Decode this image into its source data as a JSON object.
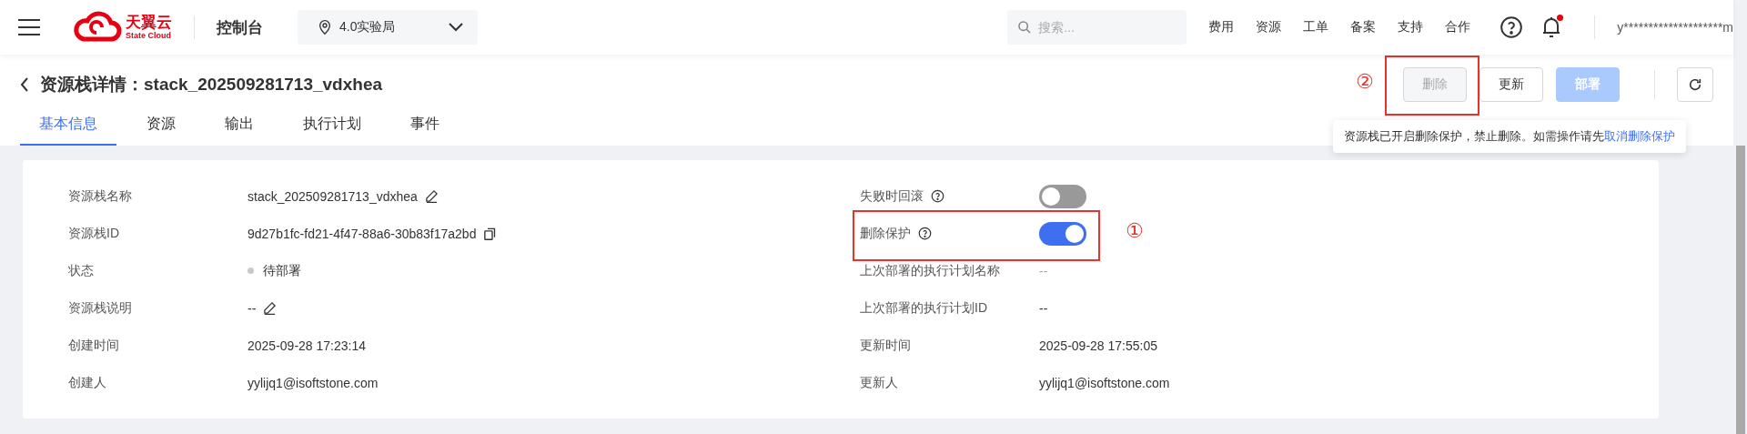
{
  "header": {
    "logo": {
      "name": "天翼云",
      "subtitle": "State Cloud"
    },
    "console_title": "控制台",
    "region": "4.0实验局",
    "search": {
      "placeholder": "搜索..."
    },
    "nav": [
      "费用",
      "资源",
      "工单",
      "备案",
      "支持",
      "合作"
    ],
    "notifications": {
      "unread": true
    },
    "user": "y********************m"
  },
  "page": {
    "title": "资源栈详情：stack_202509281713_vdxhea",
    "tabs": [
      {
        "label": "基本信息",
        "selected": true
      },
      {
        "label": "资源",
        "selected": false
      },
      {
        "label": "输出",
        "selected": false
      },
      {
        "label": "执行计划",
        "selected": false
      },
      {
        "label": "事件",
        "selected": false
      }
    ],
    "actions": [
      {
        "label": "删除",
        "kind": "default",
        "disabled": true,
        "annotation": "②"
      },
      {
        "label": "更新",
        "kind": "default",
        "disabled": false
      },
      {
        "label": "部署",
        "kind": "primary",
        "disabled": true
      }
    ],
    "tooltip": {
      "text": "资源栈已开启删除保护，禁止删除。如需操作请先",
      "link": "取消删除保护"
    }
  },
  "details": {
    "left": [
      {
        "label": "资源栈名称",
        "value": "stack_202509281713_vdxhea",
        "kind": "editable"
      },
      {
        "label": "资源栈ID",
        "value": "9d27b1fc-fd21-4f47-88a6-30b83f17a2bd",
        "kind": "copyable"
      },
      {
        "label": "状态",
        "value": "待部署",
        "kind": "status",
        "color": "#c8c9cc"
      },
      {
        "label": "资源栈说明",
        "value": "--",
        "kind": "editable"
      },
      {
        "label": "创建时间",
        "value": "2025-09-28 17:23:14",
        "kind": "text"
      },
      {
        "label": "创建人",
        "value": "yylijq1@isoftstone.com",
        "kind": "text"
      }
    ],
    "right": [
      {
        "label": "失败时回滚",
        "kind": "toggle",
        "on": false
      },
      {
        "label": "删除保护",
        "kind": "toggle",
        "on": true,
        "annotation": "①"
      },
      {
        "label": "上次部署的执行计划名称",
        "value": "--",
        "kind": "muted"
      },
      {
        "label": "上次部署的执行计划ID",
        "value": "--",
        "kind": "text"
      },
      {
        "label": "更新时间",
        "value": "2025-09-28 17:55:05",
        "kind": "text"
      },
      {
        "label": "更新人",
        "value": "yylijq1@isoftstone.com",
        "kind": "text"
      }
    ]
  }
}
